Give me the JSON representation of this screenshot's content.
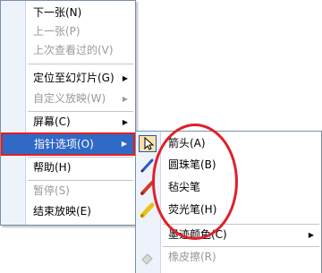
{
  "main_menu": {
    "items": [
      {
        "label": "下一张(N)",
        "disabled": false,
        "submenu": false
      },
      {
        "label": "上一张(P)",
        "disabled": true,
        "submenu": false
      },
      {
        "label": "上次查看过的(V)",
        "disabled": true,
        "submenu": false
      },
      {
        "label": "定位至幻灯片(G)",
        "disabled": false,
        "submenu": true
      },
      {
        "label": "自定义放映(W)",
        "disabled": true,
        "submenu": true
      },
      {
        "label": "屏幕(C)",
        "disabled": false,
        "submenu": true
      },
      {
        "label": "指针选项(O)",
        "disabled": false,
        "submenu": true,
        "highlighted": true
      },
      {
        "label": "帮助(H)",
        "disabled": false,
        "submenu": false
      },
      {
        "label": "暂停(S)",
        "disabled": true,
        "submenu": false
      },
      {
        "label": "结束放映(E)",
        "disabled": false,
        "submenu": false
      }
    ],
    "submenu_arrow": "▶"
  },
  "sub_menu": {
    "items": [
      {
        "label": "箭头(A)",
        "icon": "arrow-pointer-icon",
        "selected": true
      },
      {
        "label": "圆珠笔(B)",
        "icon": "ballpoint-pen-icon"
      },
      {
        "label": "毡尖笔",
        "icon": "felt-tip-pen-icon"
      },
      {
        "label": "荧光笔(H)",
        "icon": "highlighter-icon"
      },
      {
        "label": "墨迹颜色(C)",
        "icon": "",
        "submenu": true
      },
      {
        "label": "橡皮擦(R)",
        "icon": "eraser-icon",
        "disabled": true
      }
    ],
    "submenu_arrow": "▶"
  },
  "colors": {
    "highlight": "#3169c6",
    "annotation_red": "#e0202a",
    "gutter": "#eef3fb",
    "border": "#7a8fa8"
  }
}
